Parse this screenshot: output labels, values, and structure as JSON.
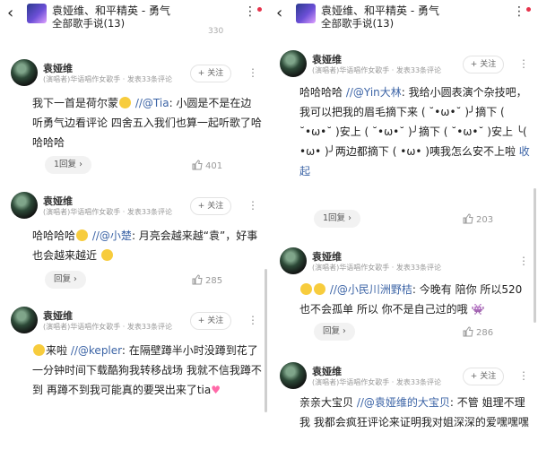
{
  "header": {
    "back_glyph": "‹",
    "song_title": "袁娅维、和平精英 - 勇气",
    "subtitle": "全部歌手说(13)",
    "more_glyph": "⋮"
  },
  "left": {
    "clipped_count": "330",
    "comments": [
      {
        "author": "袁娅维",
        "meta": "(演唱者)华语唱作女歌手 · 发表33条评论",
        "follow": "+ 关注",
        "text_a": "我下一首是荷尔蒙",
        "mention": "//@Tia",
        "text_b": ": 小圆是不是在边听勇气边看评论 四舍五入我们也算一起听歌了哈哈哈哈",
        "reply": "1回复 ›",
        "likes": "401"
      },
      {
        "author": "袁娅维",
        "meta": "(演唱者)华语唱作女歌手 · 发表33条评论",
        "follow": "+ 关注",
        "text_a": "哈哈哈哈",
        "mention": "//@小楚",
        "text_b": ": 月亮会越来越“袁”，好事也会越来越近",
        "reply": "回复 ›",
        "likes": "285"
      },
      {
        "author": "袁娅维",
        "meta": "(演唱者)华语唱作女歌手 · 发表33条评论",
        "follow": "+ 关注",
        "text_a": "来啦 ",
        "mention": "//@kepler",
        "text_b": ": 在隔壁蹲半小时没蹲到花了一分钟时间下载酷狗我转移战场 我就不信我蹲不到 再蹲不到我可能真的要哭出来了tia"
      }
    ]
  },
  "right": {
    "comments": [
      {
        "author": "袁娅维",
        "meta": "(演唱者)华语唱作女歌手 · 发表33条评论",
        "follow": "+ 关注",
        "text_a": "哈哈哈哈 ",
        "mention": "//@Yin大林",
        "text_b": ": 我给小圆表演个杂技吧，我可以把我的眉毛摘下来 ( ˘•ω•˘ )╯摘下 ( ˘•ω•˘ )安上 ( ˘•ω•˘ )╯摘下 ( ˘•ω•˘ )安上 ╰( •ω• )╯两边都摘下 ( •ω• )咦我怎么安不上啦",
        "fold": "收起",
        "reply": "1回复 ›",
        "likes": "203"
      },
      {
        "author": "袁娅维",
        "meta": "(演唱者)华语唱作女歌手 · 发表33条评论",
        "follow": "+ 关注",
        "text_a": "",
        "mention": "//@小民川洲野桔",
        "text_b": ": 今晚有 陪你 所以520也不会孤单 所以 你不是自己过的哦",
        "reply": "回复 ›",
        "likes": "286"
      },
      {
        "author": "袁娅维",
        "meta": "(演唱者)华语唱作女歌手 · 发表33条评论",
        "follow": "+ 关注",
        "text_a": "亲亲大宝贝 ",
        "mention": "//@袁娅维的大宝贝",
        "text_b": ": 不管 姐理不理我 我都会疯狂评论来证明我对姐深深的爱嘿嘿嘿"
      }
    ]
  }
}
